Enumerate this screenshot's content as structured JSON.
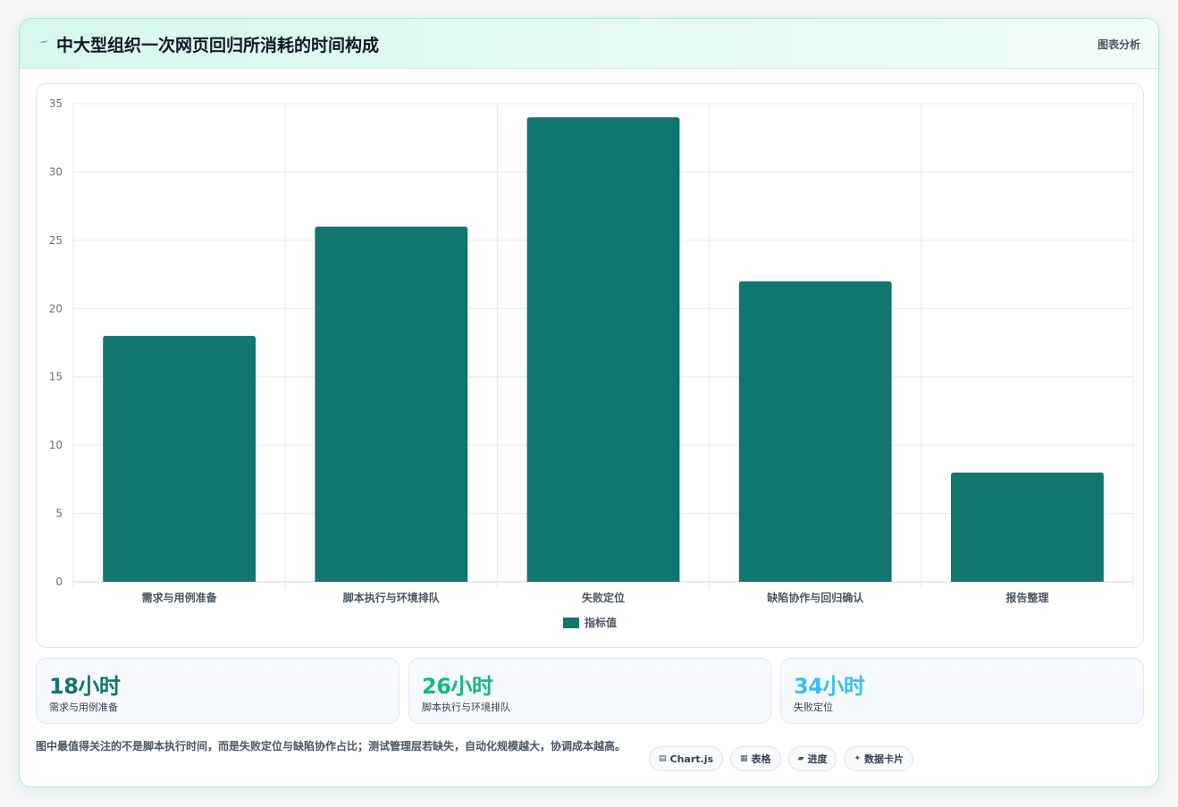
{
  "header": {
    "icon": "lightning-icon",
    "title": "中大型组织一次网页回归所消耗的时间构成",
    "link_label": "图表分析"
  },
  "chart_data": {
    "type": "bar",
    "categories": [
      "需求与用例准备",
      "脚本执行与环境排队",
      "失败定位",
      "缺陷协作与回归确认",
      "报告整理"
    ],
    "series": [
      {
        "name": "指标值",
        "values": [
          18,
          26,
          34,
          22,
          8
        ],
        "color": "#10766e"
      }
    ],
    "ylim": [
      0,
      35
    ],
    "yticks": [
      0,
      5,
      10,
      15,
      20,
      25,
      30,
      35
    ],
    "grid": true,
    "legend": "bottom-center"
  },
  "stats": [
    {
      "value": "18小时",
      "label": "需求与用例准备",
      "color": "#12766e"
    },
    {
      "value": "26小时",
      "label": "脚本执行与环境排队",
      "color": "#14b886"
    },
    {
      "value": "34小时",
      "label": "失败定位",
      "color": "#38bdf8"
    }
  ],
  "note": "图中最值得关注的不是脚本执行时间，而是失败定位与缺陷协作占比；测试管理层若缺失，自动化规模越大，协调成本越高。",
  "tags": [
    {
      "icon": "chart-icon",
      "glyph": "▤",
      "label": "Chart.js"
    },
    {
      "icon": "table-icon",
      "glyph": "▦",
      "label": "表格"
    },
    {
      "icon": "progress-icon",
      "glyph": "▰",
      "label": "进度"
    },
    {
      "icon": "sparkle-icon",
      "glyph": "✦",
      "label": "数据卡片"
    }
  ]
}
